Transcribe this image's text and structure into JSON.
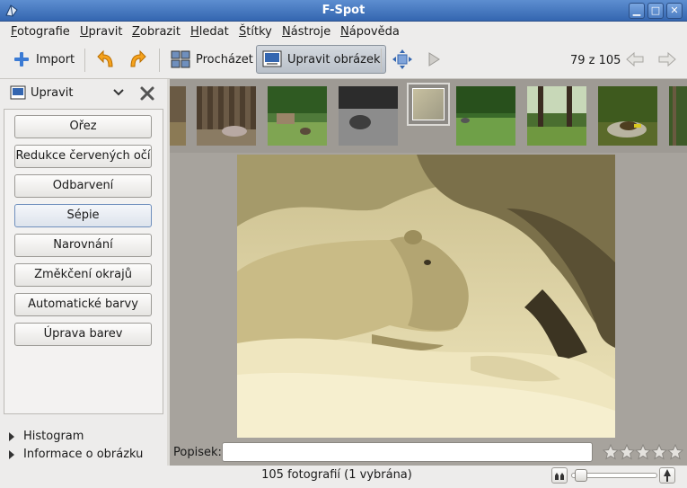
{
  "window": {
    "title": "F-Spot",
    "controls": [
      "minimize",
      "maximize",
      "close"
    ]
  },
  "menu": [
    "Fotografie",
    "Upravit",
    "Zobrazit",
    "Hledat",
    "Štítky",
    "Nástroje",
    "Nápověda"
  ],
  "toolbar": {
    "import_label": "Import",
    "browse_label": "Procházet",
    "edit_label": "Upravit obrázek",
    "counter": "79 z 105",
    "icons": [
      "add-icon",
      "rotate-left-icon",
      "rotate-right-icon",
      "browse-icon",
      "edit-image-icon",
      "fullscreen-icon",
      "slideshow-icon",
      "back-arrow-icon",
      "forward-arrow-icon"
    ]
  },
  "sidebar": {
    "mode_label": "Upravit",
    "tools": [
      "Ořez",
      "Redukce červených očí",
      "Odbarvení",
      "Sépie",
      "Narovnání",
      "Změkčení okrajů",
      "Automatické barvy",
      "Úprava barev"
    ],
    "selected_tool": "Sépie",
    "expanders": [
      "Histogram",
      "Informace o obrázku"
    ]
  },
  "caption": {
    "label": "Popisek:",
    "value": "",
    "rating_stars": 5,
    "rating": 0
  },
  "status": {
    "text": "105 fotografií (1 vybrána)",
    "zoom_level": 0.05
  },
  "colors": {
    "accent": "#3466b0",
    "sepia": "#e8dcaa",
    "background": "#a7a39d"
  }
}
